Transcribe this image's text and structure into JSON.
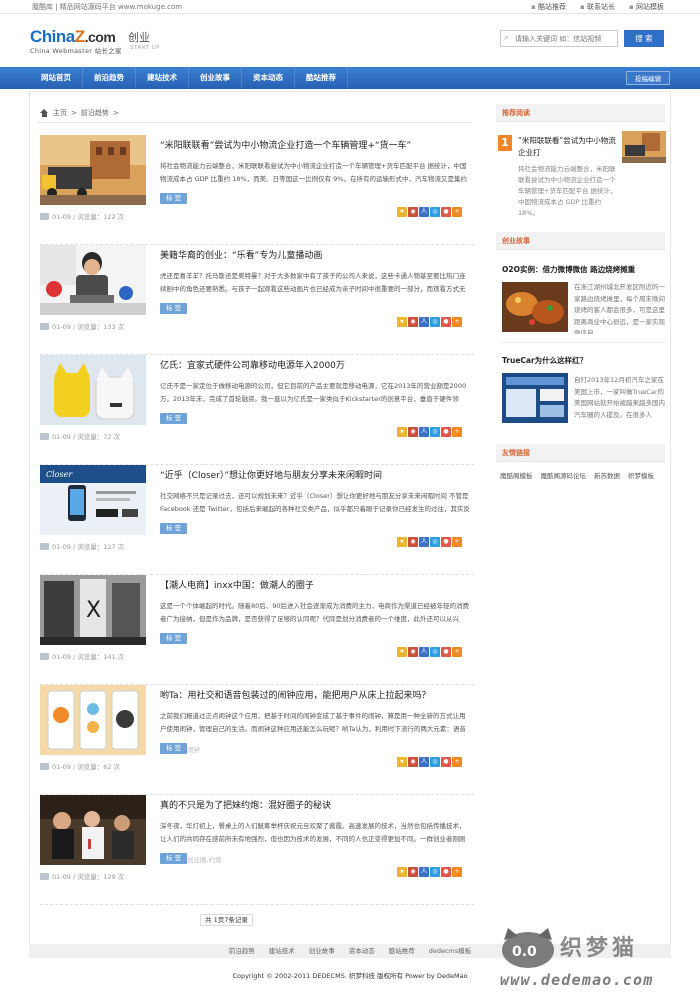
{
  "topbar": {
    "site_note": "魔酷库 | 精品网站源码平台 www.mokuge.com",
    "links": [
      "酷站推荐",
      "联系站长",
      "网站模板"
    ]
  },
  "header": {
    "brand_china": "China",
    "brand_z": "Z",
    "brand_com": ".com",
    "brand_tag": "China Webmaster 站长之家",
    "section_name": "创业",
    "section_sub": "START UP",
    "search_placeholder": "请输入关键词 如：信站视频",
    "search_button": "搜 索"
  },
  "nav": {
    "items": [
      "网站首页",
      "前沿趋势",
      "建站技术",
      "创业故事",
      "资本动态",
      "酷站推荐"
    ],
    "submit": "投稿编辑"
  },
  "breadcrumb": {
    "home": "主页",
    "sep": ">",
    "current": "前沿趋势",
    "tail": ">"
  },
  "articles": [
    {
      "title": "“米阳联联看”尝试为中小物流企业打造一个车辆管理+“货一车”",
      "desc": "将社会物流能力云端整合，米阳联联看尝试为中小物流企业打造一个车辆管理+货车匹配平台 据统计，中国物流成本占 GDP 比重约 18%，而美、日等国这一比例仅有 9%。在所有的运输形式中，汽车物流又是集约程度",
      "tag": "标 签",
      "tag_extra": "",
      "meta": "01-09 / 浏览量：122 次"
    },
    {
      "title": "美籍华裔的创业：“乐看”专为儿童播动画",
      "desc": "虎还是喜羊羊？托马斯还是奥特曼？对于大多数家中有了孩子的公司人来说，这些卡通人物基至要比热门连续剧中的角色还要熟悉。与孩子一起观看这些动画片也已经成为亲子时间中很重要的一部分，而观看方式无非就",
      "tag": "标 签",
      "tag_extra": "",
      "meta": "01-09 / 浏览量：133 次"
    },
    {
      "title": "亿氏：宜家式硬件公司靠移动电源年入2000万",
      "desc": "亿氏不是一家定位于做移动电源的公司，但它目前的产品主要就是移动电源，它在2013年的营业额是2000万。2013年末，完成了首轮融资。我一直以为亿氏是一家类似于Kickstarter的创意平台，垂直于硬件领域。但我",
      "tag": "标 签",
      "tag_extra": "",
      "meta": "01-09 / 浏览量：72 次"
    },
    {
      "title": "“近乎（Closer）”想让你更好地与朋友分享未来闲暇时间",
      "desc": "社交网络不只是记录过去，还可以规划未来？近乎（Closer）想让你更好地与朋友分享未来闲暇时间 不管是 Facebook 还是 Twitter，包括后来崛起的各种社交类产品，似乎都只着眼于记录你已经发生的过往，其实反过",
      "tag": "标 签",
      "tag_extra": "",
      "meta": "01-09 / 浏览量：127 次"
    },
    {
      "title": "【潮人电商】inxx中国：做潮人的圈子",
      "desc": "这是一个个体崛起的时代。随着80后、90后进入社会逐渐成为消费的主力，电商作为渠道已经被年轻的消费者广为接纳，但是作为品牌，是否获得了足够的认同呢？代际是划分消费者的一个维度，此外还可以从兴趣、生",
      "tag": "标 签",
      "tag_extra": "",
      "meta": "01-09 / 浏览量：141 次"
    },
    {
      "title": "哟Ta：用社交和语音包装过的闹钟应用，能把用户从床上拉起来吗？",
      "desc": "之前我们报道过正点闹钟这个应用，把基于时间的闹钟变成了基于事件的闹钟，算是用一种全新的方式让用户使用闹钟，管理自己的生活。而闹钟这种应用还能怎么玩呢？哟Ta认为，利用时下流行的两大元素：语音和社",
      "tag": "标 签",
      "tag_extra": "闹钟",
      "meta": "01-09 / 浏览量：62 次"
    },
    {
      "title": "真的不只是为了把妹约炮：混好圈子的秘诀",
      "desc": "深冬夜，华灯初上，餐桌上的人们觥筹举杯庆祝元旦欢聚了酱霞。高速发展的技术，当然也包括传播技术，让人们的共同存在感前所未有地强烈，但也因为技术的发展，不同的人也正变得更加不同。一群创业者刚刚在我",
      "tag": "标 签",
      "tag_extra": "创业圈,约炮",
      "meta": "01-09 / 浏览量：129 次"
    }
  ],
  "pager": {
    "text": "共 1页7条记录",
    "total": "1",
    "count": "7"
  },
  "sidebar": {
    "recommend_title": "推荐阅读",
    "recommend": {
      "rank": "1",
      "title": "“米阳联联看”尝试为中小物流企业打",
      "desc": "将社会物流能力云端整合，米阳联联看尝试为中小物流企业打造一个车辆管理+货车匹配平台 据统计，中国物流成本占 GDP 比重约 18%。"
    },
    "stories_title": "创业故事",
    "stories": [
      {
        "title": "O2O实例：借力微博微信 路边烧烤摊重",
        "desc": "在浙江湖州城北开发区附近的一家路边烧烤摊里，每个周末晚间烧烤的客人都会很多，可是这里距离商业中心很远，是一家实现微信自"
      },
      {
        "title": "TrueCar为什么这样红？",
        "desc": "自打2013年12月初汽车之家在美国上市，一家叫做TrueCar的美国网站就开始被越来越多国内汽车圈的人提及。在很多人"
      }
    ],
    "links_title": "友情链接",
    "links": [
      "魔酷阁模板",
      "魔酷阁源码论坛",
      "新苏数据",
      "织梦模板"
    ]
  },
  "footer": {
    "nav": [
      "前沿趋势",
      "建站技术",
      "创业故事",
      "资本动态",
      "酷站推荐",
      "dedecms模板"
    ],
    "copyright": "Copyright © 2002-2011 DEDECMS. 织梦科技 版权所有 Power by DedeMao"
  },
  "watermark": {
    "brand": "织梦猫",
    "url": "www.dedemao.com",
    "eyes": "0.0"
  },
  "colors": {
    "nav_blue": "#2f6fc8",
    "accent_orange": "#f0862a",
    "tag_blue": "#6fa3d8"
  }
}
